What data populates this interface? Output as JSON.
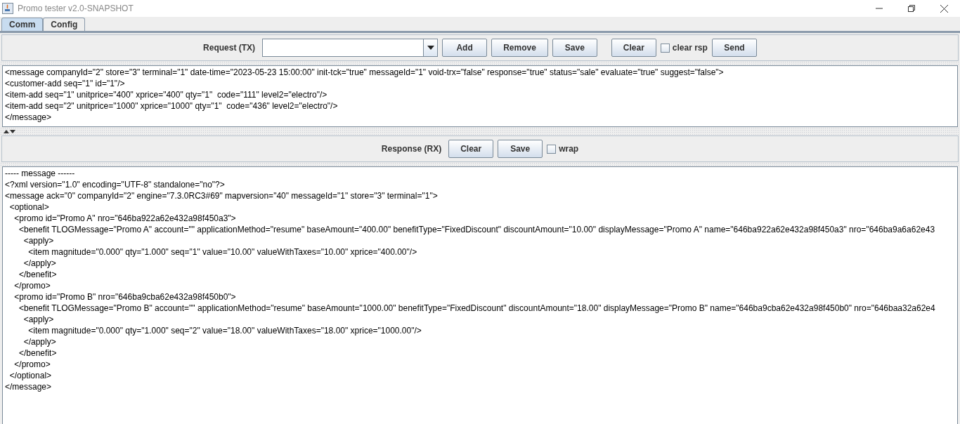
{
  "window": {
    "title": "Promo tester v2.0-SNAPSHOT"
  },
  "tabs": [
    {
      "label": "Comm",
      "selected": true
    },
    {
      "label": "Config",
      "selected": false
    }
  ],
  "request": {
    "toolbar": [
      {
        "kind": "label",
        "text": "Request (TX)"
      },
      {
        "kind": "combo"
      },
      {
        "kind": "button",
        "text": "Add"
      },
      {
        "kind": "button",
        "text": "Remove"
      },
      {
        "kind": "button",
        "text": "Save"
      },
      {
        "kind": "button",
        "text": "Clear"
      },
      {
        "kind": "checkbox",
        "text": "clear rsp",
        "checked": false
      },
      {
        "kind": "button",
        "text": "Send"
      }
    ],
    "lines": [
      "<message companyId=\"2\" store=\"3\" terminal=\"1\" date-time=\"2023-05-23 15:00:00\" init-tck=\"true\" messageId=\"1\" void-trx=\"false\" response=\"true\" status=\"sale\" evaluate=\"true\" suggest=\"false\">",
      "<customer-add seq=\"1\" id=\"1\"/>",
      "<item-add seq=\"1\" unitprice=\"400\" xprice=\"400\" qty=\"1\"  code=\"111\" level2=\"electro\"/>",
      "<item-add seq=\"2\" unitprice=\"1000\" xprice=\"1000\" qty=\"1\"  code=\"436\" level2=\"electro\"/>",
      "</message>"
    ]
  },
  "response": {
    "toolbar": [
      {
        "kind": "label",
        "text": "Response (RX)"
      },
      {
        "kind": "button",
        "text": "Clear"
      },
      {
        "kind": "button",
        "text": "Save"
      },
      {
        "kind": "checkbox",
        "text": "wrap",
        "checked": false
      }
    ],
    "lines": [
      "----- message ------",
      "<?xml version=\"1.0\" encoding=\"UTF-8\" standalone=\"no\"?>",
      "<message ack=\"0\" companyId=\"2\" engine=\"7.3.0RC3#69\" mapversion=\"40\" messageId=\"1\" store=\"3\" terminal=\"1\">",
      "  <optional>",
      "    <promo id=\"Promo A\" nro=\"646ba922a62e432a98f450a3\">",
      "      <benefit TLOGMessage=\"Promo A\" account=\"\" applicationMethod=\"resume\" baseAmount=\"400.00\" benefitType=\"FixedDiscount\" discountAmount=\"10.00\" displayMessage=\"Promo A\" name=\"646ba922a62e432a98f450a3\" nro=\"646ba9a6a62e43",
      "        <apply>",
      "          <item magnitude=\"0.000\" qty=\"1.000\" seq=\"1\" value=\"10.00\" valueWithTaxes=\"10.00\" xprice=\"400.00\"/>",
      "        </apply>",
      "      </benefit>",
      "    </promo>",
      "    <promo id=\"Promo B\" nro=\"646ba9cba62e432a98f450b0\">",
      "      <benefit TLOGMessage=\"Promo B\" account=\"\" applicationMethod=\"resume\" baseAmount=\"1000.00\" benefitType=\"FixedDiscount\" discountAmount=\"18.00\" displayMessage=\"Promo B\" name=\"646ba9cba62e432a98f450b0\" nro=\"646baa32a62e4",
      "        <apply>",
      "          <item magnitude=\"0.000\" qty=\"1.000\" seq=\"2\" value=\"18.00\" valueWithTaxes=\"18.00\" xprice=\"1000.00\"/>",
      "        </apply>",
      "      </benefit>",
      "    </promo>",
      "  </optional>",
      "</message>"
    ]
  }
}
